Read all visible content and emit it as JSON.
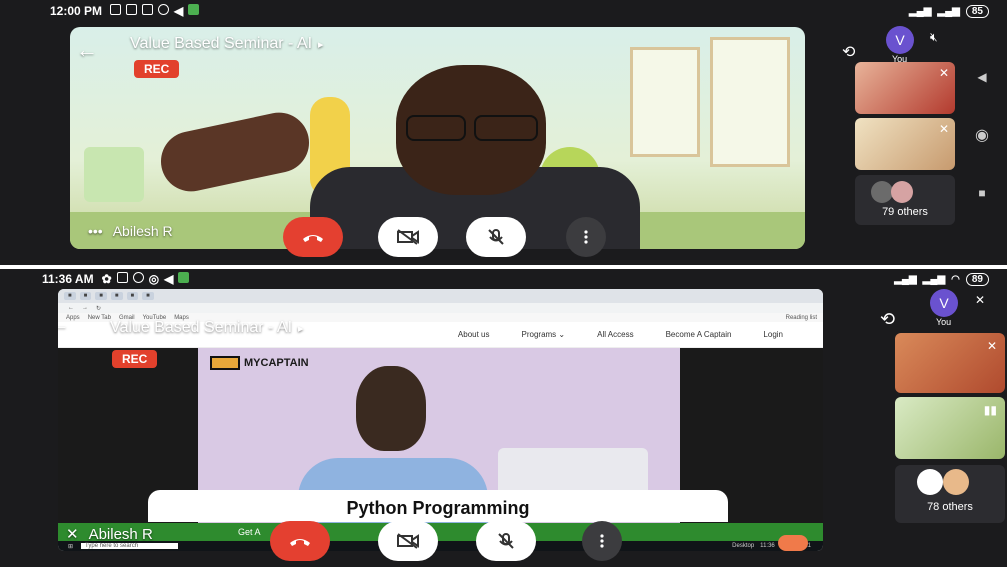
{
  "top": {
    "status": {
      "time": "12:00 PM",
      "battery": "85"
    },
    "title": "Value Based Seminar - AI",
    "rec": "REC",
    "speaker": "Abilesh R",
    "more_dots": "•••",
    "avatar_letter": "V",
    "you_label": "You",
    "others": "79 others"
  },
  "bottom": {
    "status": {
      "time": "11:36 AM",
      "battery": "89"
    },
    "title": "Value Based Seminar - AI",
    "rec": "REC",
    "speaker": "Abilesh R",
    "avatar_letter": "V",
    "you_label": "You",
    "others": "78 others",
    "site_nav": [
      "About us",
      "Programs",
      "All Access",
      "Become A Captain",
      "Login"
    ],
    "brand": "MYCAPTAIN",
    "promo_title": "Python Programming",
    "bookmarks": [
      "Apps",
      "New Tab",
      "Gmail",
      "YouTube",
      "Maps"
    ],
    "reading_list": "Reading list",
    "share_banner": "Get A",
    "taskbar_search": "Type here to search",
    "taskbar_desktop": "Desktop",
    "taskbar_clock": "11:36",
    "taskbar_date": "11-06-2021"
  },
  "icons": {
    "back": "←",
    "caret": "▸",
    "end_call": "phone-hangup-icon",
    "camera_off": "camera-off-icon",
    "mic_off": "mic-off-icon",
    "more": "more-vert-icon"
  },
  "colors": {
    "rec_red": "#e2412c",
    "end_call_red": "#e44030",
    "avatar_purple": "#6a52cf"
  }
}
